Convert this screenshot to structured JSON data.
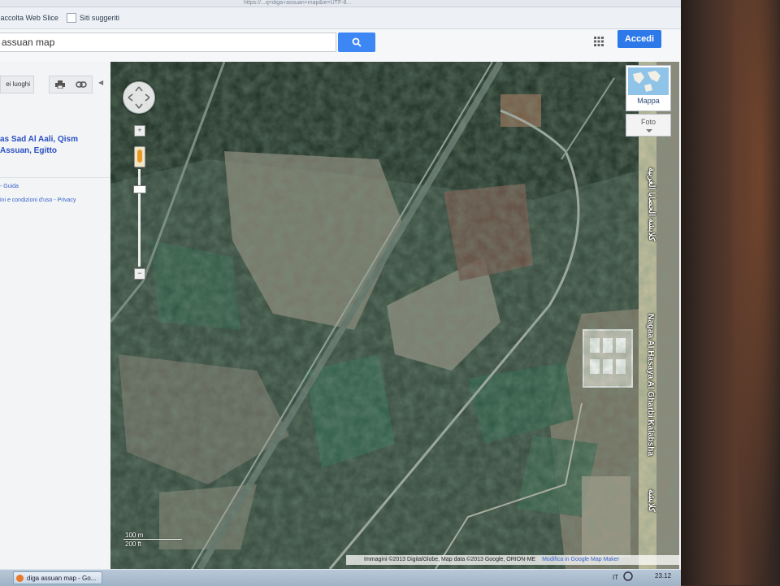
{
  "browser": {
    "url": "https://...q=diga+assuan+map&ie=UTF-8...",
    "bookmarks": [
      "Raccolta Web Slice",
      "Siti suggeriti"
    ]
  },
  "header": {
    "search_value": "assuan map",
    "login_label": "Accedi",
    "icons": [
      "search-icon",
      "apps-grid-icon"
    ]
  },
  "left_panel": {
    "places_tab": "ei luoghi",
    "place_title": "as Sad Al Aali, Qism Assuan, Egitto",
    "guide_link": "- Guida",
    "terms_link": "ini e condizioni d'uso - Privacy",
    "icons": [
      "print-icon",
      "link-icon",
      "collapse-icon"
    ]
  },
  "map": {
    "map_types": {
      "map": "Mappa",
      "satellite": "Foto"
    },
    "road_labels": [
      "كلابشة الحصايا الغربية",
      "Nagaa Al Hasaya Al Gharbi Kalabsha",
      "كلابشة"
    ],
    "scale": {
      "top": "100 m",
      "bottom": "200 ft"
    },
    "attribution": "Immagini ©2013 DigitalGlobe, Map data ©2013 Google, ORION-ME",
    "report_link": "Modifica in Google Map Maker",
    "zoom_in": "+",
    "zoom_out": "−",
    "zoom_level": 0.85
  },
  "taskbar": {
    "task_label": "diga assuan map - Go...",
    "tray_lang": "IT",
    "clock": "23.12"
  },
  "colors": {
    "accent_blue": "#3d87f5",
    "login_blue": "#2d79ea",
    "link_blue": "#2a4fc1"
  }
}
